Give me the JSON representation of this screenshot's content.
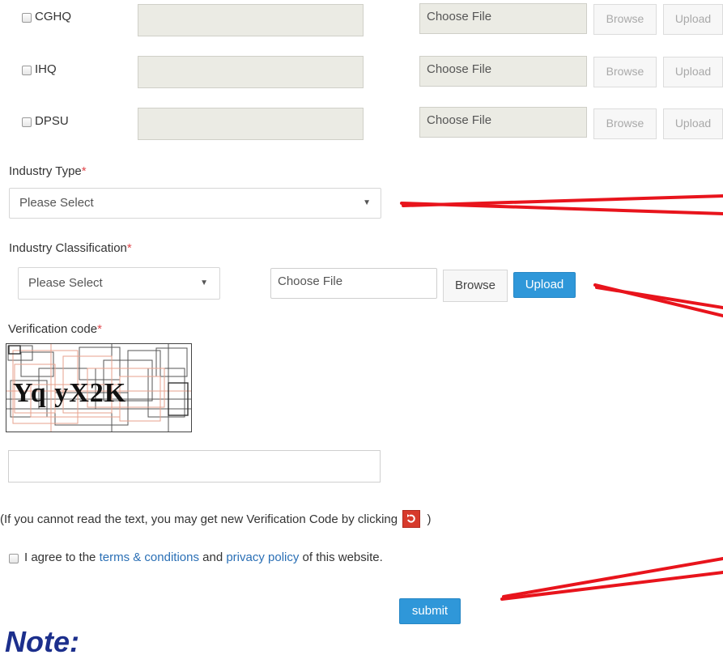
{
  "hq_rows": [
    {
      "label": "CGHQ",
      "file_placeholder": "Choose File",
      "browse": "Browse",
      "upload": "Upload"
    },
    {
      "label": "IHQ",
      "file_placeholder": "Choose File",
      "browse": "Browse",
      "upload": "Upload"
    },
    {
      "label": "DPSU",
      "file_placeholder": "Choose File",
      "browse": "Browse",
      "upload": "Upload"
    }
  ],
  "industry_type": {
    "label": "Industry Type",
    "required_mark": "*",
    "selected": "Please Select"
  },
  "industry_classification": {
    "label": "Industry Classification",
    "required_mark": "*",
    "selected": "Please Select",
    "file_placeholder": "Choose File",
    "browse": "Browse",
    "upload": "Upload"
  },
  "verification": {
    "label": "Verification code",
    "required_mark": "*",
    "captcha_text": "Yq yX2K",
    "input_value": "",
    "help_prefix": "(If you cannot read the text, you may get new Verification Code by clicking",
    "help_suffix": ")"
  },
  "agreement": {
    "prefix": "I agree to the",
    "terms_link": "terms & conditions",
    "middle": "and",
    "privacy_link": "privacy policy",
    "suffix": "of this website."
  },
  "submit_label": "submit",
  "note_heading": "Note:",
  "colors": {
    "accent_blue": "#2f97d9",
    "annotation_red": "#e8141c",
    "required": "#e0474c",
    "note": "#1c2f8c"
  }
}
